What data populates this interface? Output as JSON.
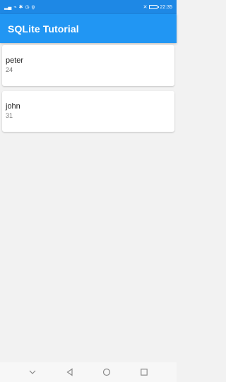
{
  "status_bar": {
    "time": "22:35",
    "icons_left": [
      "signal-icon",
      "wifi-icon",
      "bluetooth-icon",
      "alarm-icon",
      "usb-icon"
    ],
    "icons_right": [
      "mute-icon",
      "battery-icon"
    ]
  },
  "app_bar": {
    "title": "SQLite Tutorial"
  },
  "people": [
    {
      "name": "peter",
      "age": "24"
    },
    {
      "name": "john",
      "age": "31"
    }
  ],
  "nav_bar": {
    "buttons": [
      "down-icon",
      "back-icon",
      "home-icon",
      "recents-icon"
    ]
  },
  "colors": {
    "status_bar": "#1e88e5",
    "app_bar": "#2196f3",
    "background": "#f2f2f2"
  }
}
